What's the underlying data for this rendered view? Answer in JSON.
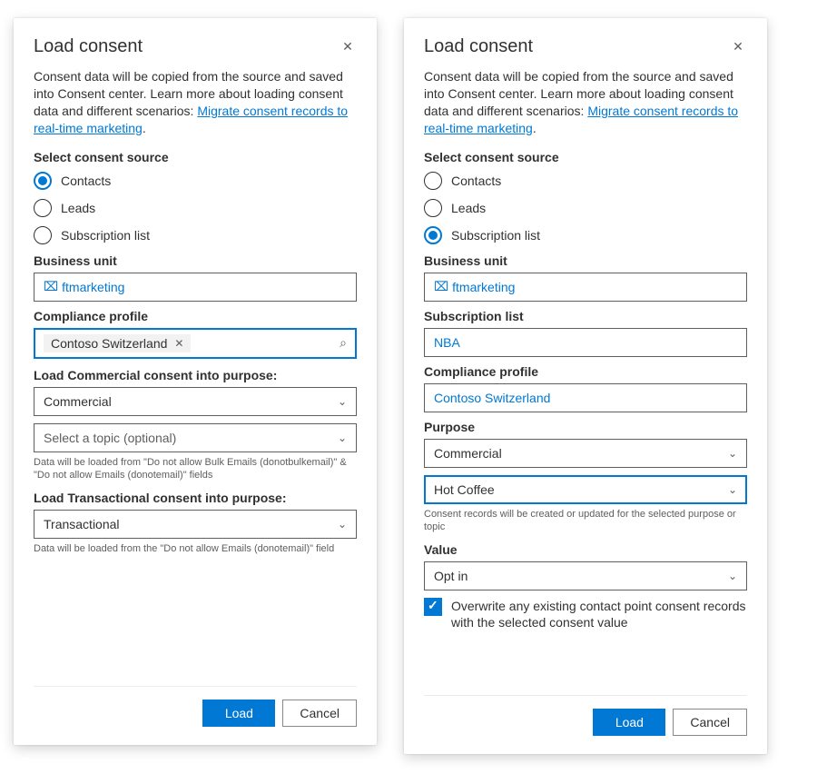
{
  "left": {
    "title": "Load consent",
    "intro_pre": "Consent data will be copied from the source and saved into Consent center. Learn more about loading consent data and different scenarios: ",
    "intro_link": "Migrate consent records to real-time marketing",
    "intro_post": ".",
    "source_label": "Select consent source",
    "radios": {
      "contacts": "Contacts",
      "leads": "Leads",
      "sublist": "Subscription list"
    },
    "selected_radio": "contacts",
    "bu_label": "Business unit",
    "bu_value": "ftmarketing",
    "cp_label": "Compliance profile",
    "cp_value": "Contoso Switzerland",
    "commercial_label": "Load Commercial consent into purpose:",
    "commercial_value": "Commercial",
    "topic_placeholder": "Select a topic (optional)",
    "commercial_hint": "Data will be loaded from \"Do not allow Bulk Emails (donotbulkemail)\" & \"Do not allow Emails (donotemail)\" fields",
    "trans_label": "Load Transactional consent into purpose:",
    "trans_value": "Transactional",
    "trans_hint": "Data will be loaded from the \"Do not allow Emails (donotemail)\" field",
    "load_btn": "Load",
    "cancel_btn": "Cancel"
  },
  "right": {
    "title": "Load consent",
    "intro_pre": "Consent data will be copied from the source and saved into Consent center. Learn more about loading consent data and different scenarios: ",
    "intro_link": "Migrate consent records to real-time marketing",
    "intro_post": ".",
    "source_label": "Select consent source",
    "radios": {
      "contacts": "Contacts",
      "leads": "Leads",
      "sublist": "Subscription list"
    },
    "selected_radio": "sublist",
    "bu_label": "Business unit",
    "bu_value": "ftmarketing",
    "sl_label": "Subscription list",
    "sl_value": "NBA",
    "cp_label": "Compliance profile",
    "cp_value": "Contoso Switzerland",
    "purpose_label": "Purpose",
    "purpose_value": "Commercial",
    "topic_value": "Hot Coffee",
    "purpose_hint": "Consent records will be created or updated for the selected purpose or topic",
    "value_label": "Value",
    "value_value": "Opt in",
    "overwrite_label": "Overwrite any existing contact point consent records with the selected consent value",
    "load_btn": "Load",
    "cancel_btn": "Cancel"
  }
}
